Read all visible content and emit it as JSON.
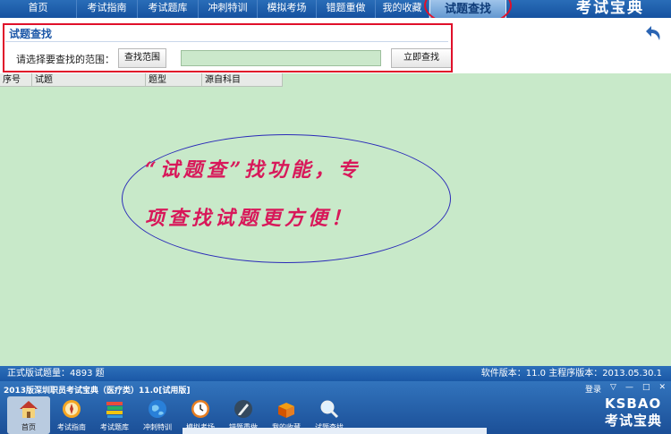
{
  "nav": {
    "items": [
      "首页",
      "考试指南",
      "考试题库",
      "冲刺特训",
      "模拟考场",
      "错题重做",
      "我的收藏"
    ],
    "active": "试题查找",
    "brand": "考试宝典"
  },
  "search": {
    "title": "试题查找",
    "range_label": "请选择要查找的范围：",
    "range_button": "查找范围",
    "input_value": "",
    "search_button": "立即查找"
  },
  "grid": {
    "columns": [
      "序号",
      "试题",
      "题型",
      "源自科目"
    ]
  },
  "annotation": {
    "line1": "“试题查”找功能，专",
    "line2": "项查找试题更方便！"
  },
  "status": {
    "left": "正式版试题量：4893 题",
    "right": "软件版本：11.0 主程序版本：2013.05.30.1"
  },
  "appbar": {
    "title": "2013版深圳职员考试宝典（医疗类）11.0[试用版]",
    "controls": [
      "登录",
      "▽",
      "—",
      "□",
      "✕"
    ],
    "dock": [
      {
        "label": "首页",
        "icon": "home-icon"
      },
      {
        "label": "考试指南",
        "icon": "compass-icon"
      },
      {
        "label": "考试题库",
        "icon": "books-icon"
      },
      {
        "label": "冲刺特训",
        "icon": "globe-icon"
      },
      {
        "label": "模拟考场",
        "icon": "clock-icon"
      },
      {
        "label": "错题重做",
        "icon": "pen-icon"
      },
      {
        "label": "我的收藏",
        "icon": "box-icon"
      },
      {
        "label": "试题查找",
        "icon": "magnifier-icon"
      }
    ],
    "brand_en": "KSBAO",
    "brand_cn": "考试宝典"
  },
  "colors": {
    "nav_bg": "#1c5aa6",
    "grid_bg": "#c8e9c9",
    "highlight": "#e0102a",
    "annotation_text": "#d8185a",
    "annotation_ellipse": "#2a2ab8"
  }
}
